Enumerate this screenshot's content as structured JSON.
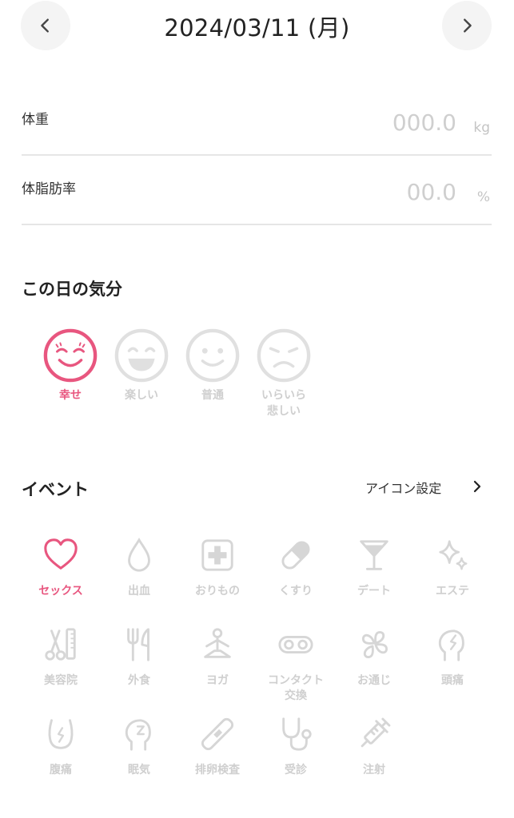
{
  "header": {
    "date": "2024/03/11 (月)",
    "prev_icon": "chevron-left-icon",
    "next_icon": "chevron-right-icon"
  },
  "measurements": {
    "weight": {
      "label": "体重",
      "placeholder": "000.0",
      "unit": "kg"
    },
    "body_fat": {
      "label": "体脂肪率",
      "placeholder": "00.0",
      "unit": "%"
    }
  },
  "mood": {
    "title": "この日の気分",
    "options": [
      {
        "label": "幸せ",
        "icon": "happy-face-icon",
        "selected": true
      },
      {
        "label": "楽しい",
        "icon": "laughing-face-icon",
        "selected": false
      },
      {
        "label": "普通",
        "icon": "smiling-face-icon",
        "selected": false
      },
      {
        "label": "いらいら\n悲しい",
        "icon": "sad-face-icon",
        "selected": false
      }
    ]
  },
  "events": {
    "title": "イベント",
    "settings_label": "アイコン設定",
    "items": [
      {
        "label": "セックス",
        "icon": "heart-icon",
        "selected": true
      },
      {
        "label": "出血",
        "icon": "drop-icon",
        "selected": false
      },
      {
        "label": "おりもの",
        "icon": "cross-box-icon",
        "selected": false
      },
      {
        "label": "くすり",
        "icon": "pill-icon",
        "selected": false
      },
      {
        "label": "デート",
        "icon": "cocktail-icon",
        "selected": false
      },
      {
        "label": "エステ",
        "icon": "sparkle-icon",
        "selected": false
      },
      {
        "label": "美容院",
        "icon": "scissors-comb-icon",
        "selected": false
      },
      {
        "label": "外食",
        "icon": "fork-knife-icon",
        "selected": false
      },
      {
        "label": "ヨガ",
        "icon": "yoga-icon",
        "selected": false
      },
      {
        "label": "コンタクト\n交換",
        "icon": "contact-lens-icon",
        "selected": false
      },
      {
        "label": "お通じ",
        "icon": "clover-icon",
        "selected": false
      },
      {
        "label": "頭痛",
        "icon": "headache-icon",
        "selected": false
      },
      {
        "label": "腹痛",
        "icon": "stomachache-icon",
        "selected": false
      },
      {
        "label": "眠気",
        "icon": "sleepy-head-icon",
        "selected": false
      },
      {
        "label": "排卵検査",
        "icon": "test-stick-icon",
        "selected": false
      },
      {
        "label": "受診",
        "icon": "stethoscope-icon",
        "selected": false
      },
      {
        "label": "注射",
        "icon": "syringe-icon",
        "selected": false
      }
    ]
  },
  "colors": {
    "accent": "#e8567f",
    "inactive": "#d2d2d2",
    "divider": "#e6e6e6"
  }
}
